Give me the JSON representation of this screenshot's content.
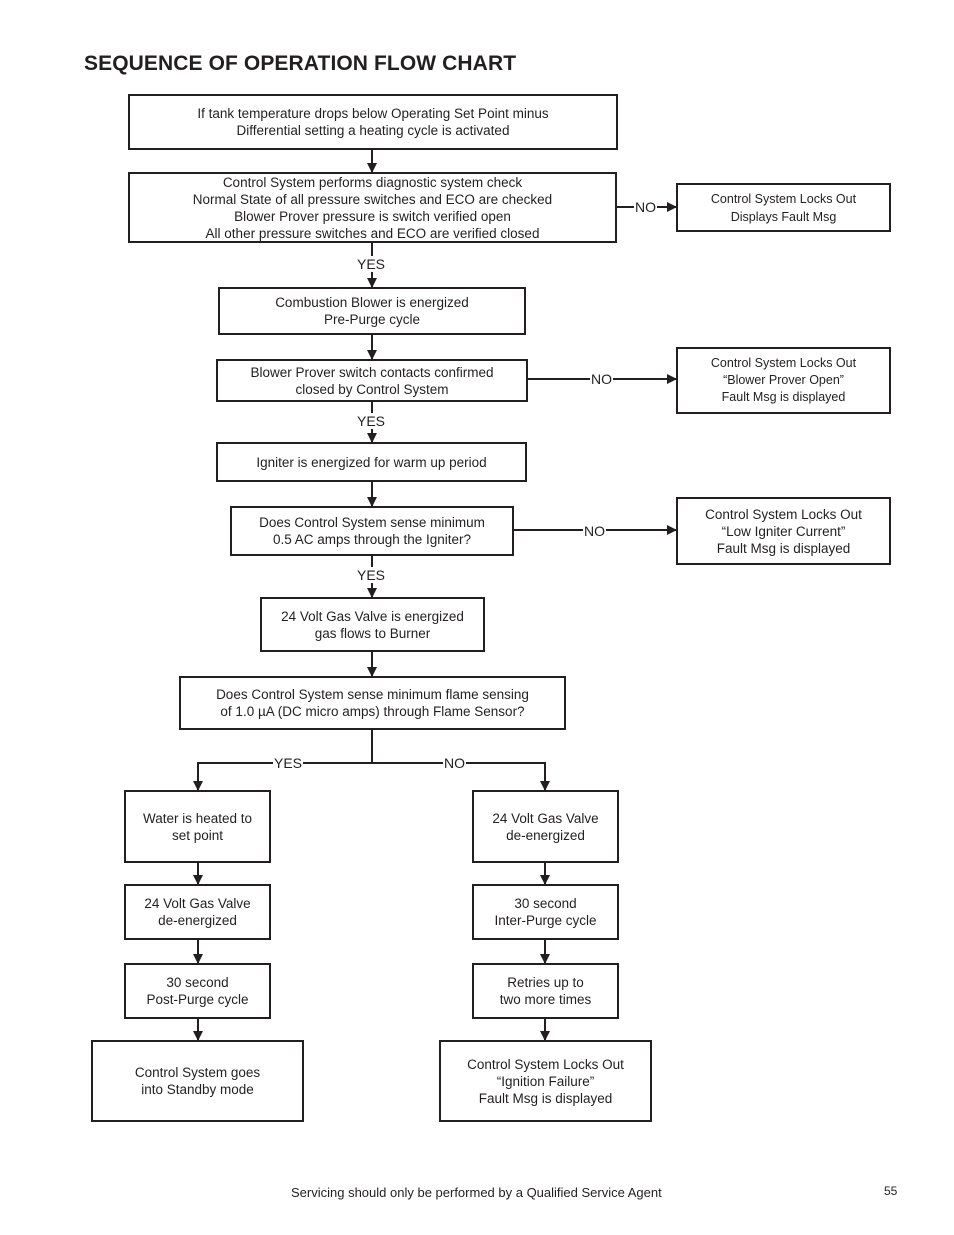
{
  "page": {
    "title": "SEQUENCE OF OPERATION FLOW CHART",
    "footer": "Servicing should only be performed by a Qualified Service Agent",
    "page_number": "55"
  },
  "flowchart": {
    "steps": {
      "start": [
        "If tank temperature drops below Operating Set Point minus",
        "Differential setting a heating cycle is activated"
      ],
      "diagnostic": [
        "Control System performs diagnostic system check",
        "Normal State of all pressure switches and ECO are checked",
        "Blower Prover pressure is switch verified open",
        "All other pressure switches and ECO are verified closed"
      ],
      "lockout_fault": [
        "Control System Locks Out",
        "Displays Fault Msg"
      ],
      "blower": [
        "Combustion Blower is energized",
        "Pre-Purge cycle"
      ],
      "prover": [
        "Blower Prover switch contacts confirmed",
        "closed by Control System"
      ],
      "lockout_prover": [
        "Control System Locks Out",
        "“Blower Prover Open”",
        "Fault Msg is displayed"
      ],
      "igniter": [
        "Igniter is energized for warm up period"
      ],
      "igniter_check": [
        "Does Control System sense minimum",
        "0.5 AC amps through the Igniter?"
      ],
      "lockout_igniter": [
        "Control System Locks Out",
        "“Low Igniter Current”",
        "Fault Msg is displayed"
      ],
      "gas_valve": [
        "24 Volt Gas Valve is energized",
        "gas flows to Burner"
      ],
      "flame_check": [
        "Does Control System sense minimum flame sensing",
        "of 1.0 µA (DC micro amps) through Flame Sensor?"
      ],
      "yes_heated": [
        "Water is heated to",
        "set point"
      ],
      "yes_valve_off": [
        "24 Volt Gas Valve",
        "de-energized"
      ],
      "yes_postpurge": [
        "30 second",
        "Post-Purge cycle"
      ],
      "yes_standby": [
        "Control System goes",
        "into Standby mode"
      ],
      "no_valve_off": [
        "24 Volt Gas Valve",
        "de-energized"
      ],
      "no_interpurge": [
        "30 second",
        "Inter-Purge cycle"
      ],
      "no_retries": [
        "Retries up to",
        "two more times"
      ],
      "no_lockout": [
        "Control System Locks Out",
        "“Ignition Failure”",
        "Fault Msg is displayed"
      ]
    },
    "labels": {
      "yes": "YES",
      "no": "NO"
    }
  }
}
